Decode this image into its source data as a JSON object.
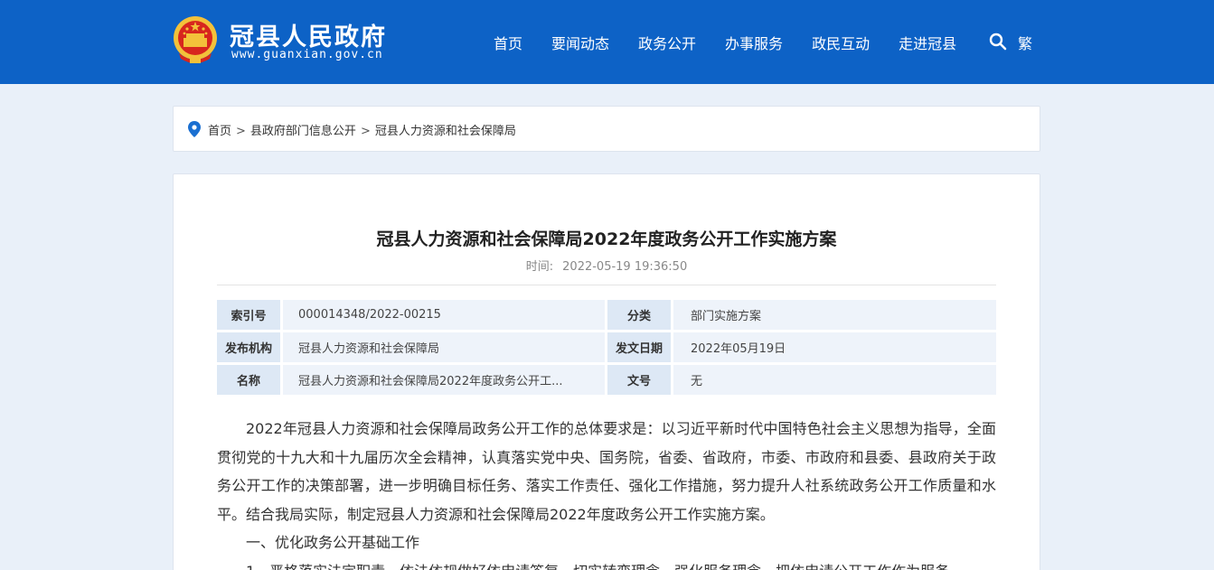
{
  "header": {
    "site_name": "冠县人民政府",
    "site_url": "www.guanxian.gov.cn",
    "nav": [
      "首页",
      "要闻动态",
      "政务公开",
      "办事服务",
      "政民互动",
      "走进冠县"
    ],
    "search_icon": "search-icon",
    "traditional_label": "繁"
  },
  "breadcrumb": {
    "items": [
      "首页",
      "县政府部门信息公开",
      "冠县人力资源和社会保障局"
    ],
    "separator": ">"
  },
  "article": {
    "title": "冠县人力资源和社会保障局2022年度政务公开工作实施方案",
    "time_label": "时间:",
    "time_value": "2022-05-19 19:36:50",
    "info": [
      {
        "k1": "索引号",
        "v1": "000014348/2022-00215",
        "k2": "分类",
        "v2": "部门实施方案"
      },
      {
        "k1": "发布机构",
        "v1": "冠县人力资源和社会保障局",
        "k2": "发文日期",
        "v2": "2022年05月19日"
      },
      {
        "k1": "名称",
        "v1": "冠县人力资源和社会保障局2022年度政务公开工...",
        "k2": "文号",
        "v2": "无"
      }
    ],
    "paragraphs": [
      "2022年冠县人力资源和社会保障局政务公开工作的总体要求是：以习近平新时代中国特色社会主义思想为指导，全面贯彻党的十九大和十九届历次全会精神，认真落实党中央、国务院，省委、省政府，市委、市政府和县委、县政府关于政务公开工作的决策部署，进一步明确目标任务、落实工作责任、强化工作措施，努力提升人社系统政务公开工作质量和水平。结合我局实际，制定冠县人力资源和社会保障局2022年度政务公开工作实施方案。",
      "一、优化政务公开基础工作",
      "1、严格落实法定职责，依法依规做好依申请答复，切实转变理念，强化服务理念，把依申请公开工作作为服务"
    ]
  },
  "colors": {
    "header_bg": "#0d62c6",
    "page_bg": "#e9f0f9",
    "table_header_bg": "#dde8f5",
    "table_value_bg": "#eef3fa"
  }
}
